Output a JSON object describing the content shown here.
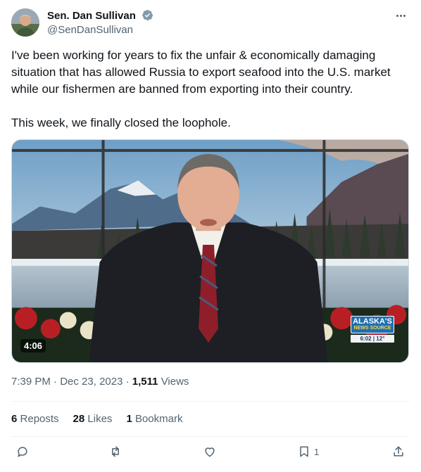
{
  "author": {
    "name": "Sen. Dan Sullivan",
    "handle": "@SenDanSullivan",
    "verified_icon": "verified-badge-icon",
    "verified_color": "#829aab"
  },
  "tweet": {
    "paragraphs": [
      "I've been working for years to fix the unfair & economically damaging situation that has allowed Russia to export seafood into the U.S. market while our fishermen are banned from exporting into their country.",
      "This week, we finally closed the loophole."
    ]
  },
  "media": {
    "type": "video",
    "duration": "4:06",
    "station_logo": {
      "line1": "ALASKA'S",
      "line2": "NEWS SOURCE",
      "time": "6:02",
      "temp": "12°"
    }
  },
  "meta": {
    "time": "7:39 PM",
    "date": "Dec 23, 2023",
    "views_count": "1,511",
    "views_label": "Views"
  },
  "stats": {
    "reposts_count": "6",
    "reposts_label": "Reposts",
    "likes_count": "28",
    "likes_label": "Likes",
    "bookmarks_count": "1",
    "bookmarks_label": "Bookmark"
  },
  "actions": {
    "reply_icon": "reply-icon",
    "repost_icon": "repost-icon",
    "like_icon": "like-icon",
    "bookmark_icon": "bookmark-icon",
    "bookmark_count": "1",
    "share_icon": "share-icon"
  },
  "colors": {
    "text_primary": "#0f1419",
    "text_secondary": "#536471",
    "divider": "#eff3f4"
  }
}
